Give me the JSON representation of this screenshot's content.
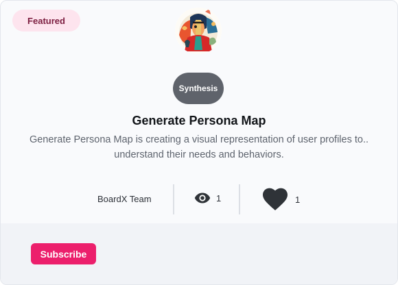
{
  "card": {
    "badge": "Featured",
    "category": "Synthesis",
    "title": "Generate Persona Map",
    "description": "Generate Persona Map is creating a visual representation of user profiles to.. understand their needs and behaviors.",
    "author": "BoardX Team",
    "views": "1",
    "likes": "1",
    "subscribe_label": "Subscribe",
    "icons": {
      "views": "eye-icon",
      "likes": "heart-icon",
      "avatar": "persona-illustration"
    },
    "colors": {
      "badge_bg": "#fde4ee",
      "badge_text": "#7b1d3f",
      "category_bg": "#5f636b",
      "subscribe_bg": "#ec1f6c"
    }
  }
}
